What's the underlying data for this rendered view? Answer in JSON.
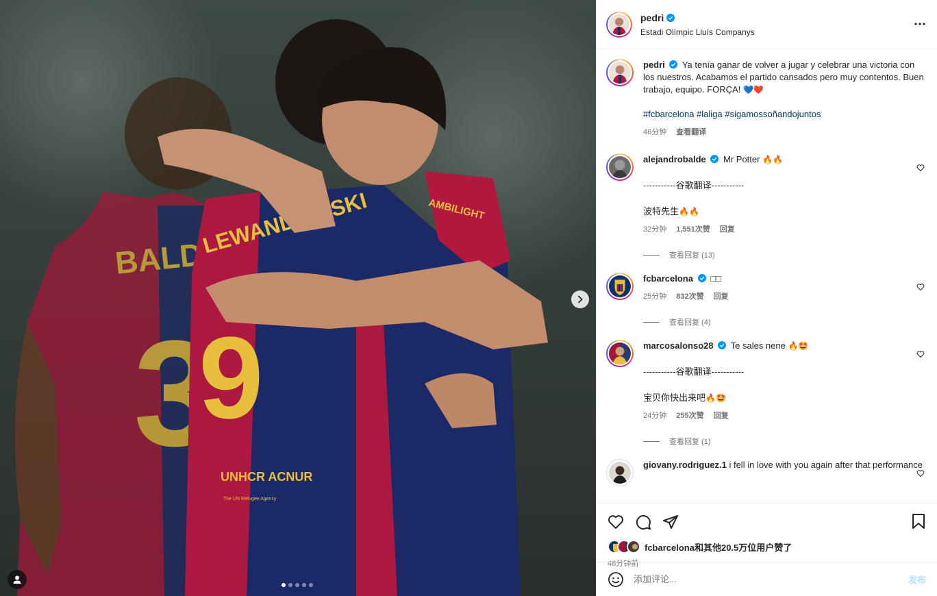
{
  "post": {
    "username": "pedri",
    "location": "Estadi Olímpic Lluís Companys",
    "caption": "Ya tenía ganar de volver a jugar y celebrar una victoria con los nuestros. Acabamos el partido cansados pero muy contentos. Buen trabajo, equipo. FORÇA!",
    "caption_emoji": "💙❤️",
    "hashtags": "#fcbarcelona #laliga #sigamossoñandojuntos",
    "time": "46分钟",
    "translate": "查看翻译"
  },
  "comments": [
    {
      "username": "alejandrobalde",
      "text": "Mr Potter",
      "emoji": "🔥🔥",
      "translation_header": "-----------谷歌翻译-----------",
      "translation": "波特先生",
      "translation_emoji": "🔥🔥",
      "time": "32分钟",
      "likes": "1,551次赞",
      "reply": "回复",
      "view_replies": "查看回复 (13)"
    },
    {
      "username": "fcbarcelona",
      "text": "□□",
      "time": "25分钟",
      "likes": "832次赞",
      "reply": "回复",
      "view_replies": "查看回复 (4)"
    },
    {
      "username": "marcosalonso28",
      "text": "Te sales nene",
      "emoji": "🔥🤩",
      "translation_header": "-----------谷歌翻译-----------",
      "translation": "宝贝你快出来吧",
      "translation_emoji": "🔥🤩",
      "time": "24分钟",
      "likes": "255次赞",
      "reply": "回复",
      "view_replies": "查看回复 (1)"
    },
    {
      "username": "giovany.rodriguez.1",
      "text": "i fell in love with you again after that performance"
    }
  ],
  "likes_summary": "fcbarcelona和其他20.5万位用户赞了",
  "posted_ago": "46分钟前",
  "add_comment_placeholder": "添加评论...",
  "post_button": "发布",
  "jersey": {
    "back_name": "LEWANDOWSKI",
    "back_number": "9",
    "sponsor": "UNHCR ACNUR",
    "sponsor_sub": "The UN Refugee Agency",
    "sleeve": "AMBILIGHT",
    "other_name": "BALDE",
    "other_number": "3"
  },
  "carousel": {
    "count": 5,
    "active": 1
  },
  "colors": {
    "link": "#00376b",
    "verified": "#0095f6",
    "muted": "#737373",
    "post_button": "#b2dffc"
  }
}
